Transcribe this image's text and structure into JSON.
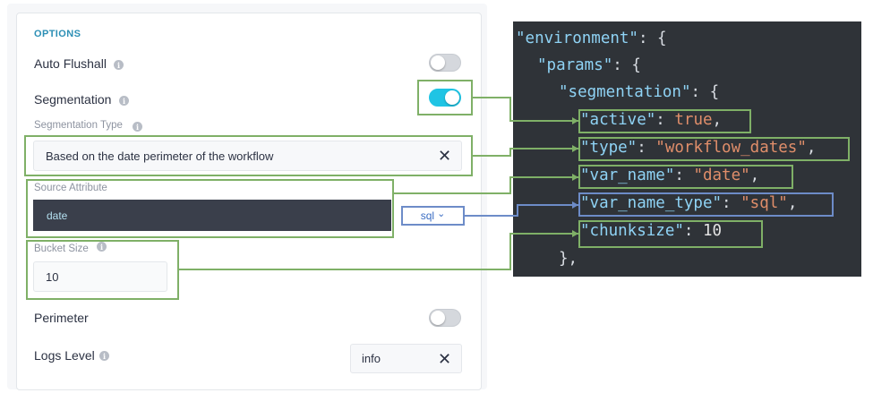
{
  "options": {
    "section_title": "OPTIONS",
    "auto_flushall": {
      "label": "Auto Flushall",
      "enabled": false
    },
    "segmentation": {
      "label": "Segmentation",
      "enabled": true
    },
    "segmentation_type": {
      "label": "Segmentation Type",
      "value": "Based on the date perimeter of the workflow"
    },
    "source_attribute": {
      "label": "Source Attribute",
      "value": "date",
      "type_select": "sql"
    },
    "bucket_size": {
      "label": "Bucket Size",
      "value": "10"
    },
    "perimeter": {
      "label": "Perimeter",
      "enabled": false
    },
    "logs_level": {
      "label": "Logs Level",
      "value": "info"
    }
  },
  "icons": {
    "info": "info-icon",
    "clear": "close-icon",
    "dropdown": "chevron-down-icon"
  },
  "glyphs": {
    "info": "i",
    "clear": "✕",
    "chevron": "⌄"
  },
  "code": {
    "environment_key": "\"environment\"",
    "params_key": "\"params\"",
    "segmentation_key": "\"segmentation\"",
    "active_key": "\"active\"",
    "active_value": "true",
    "type_key": "\"type\"",
    "type_value": "\"workflow_dates\"",
    "var_name_key": "\"var_name\"",
    "var_name_value": "\"date\"",
    "var_name_type_key": "\"var_name_type\"",
    "var_name_type_value": "\"sql\"",
    "chunksize_key": "\"chunksize\"",
    "chunksize_value": "10"
  },
  "colors": {
    "accent": "#1fc4e4",
    "section_title": "#2c8fb5",
    "annotation_green": "#7fb067",
    "annotation_blue": "#6d8cc8",
    "code_background": "#2f3338"
  }
}
